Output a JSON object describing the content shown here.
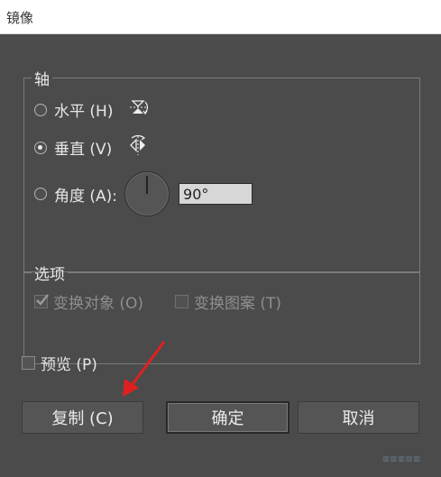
{
  "window": {
    "title": "镜像"
  },
  "axis": {
    "legend": "轴",
    "options": [
      {
        "label": "水平 (H)",
        "checked": false,
        "icon": "mirror-horizontal-icon"
      },
      {
        "label": "垂直 (V)",
        "checked": true,
        "icon": "mirror-vertical-icon"
      },
      {
        "label": "角度 (A):",
        "checked": false,
        "icon": "angle-dial-icon"
      }
    ],
    "angle_value": "90°"
  },
  "options": {
    "legend": "选项",
    "transform_objects": {
      "label": "变换对象 (O)",
      "checked": true,
      "disabled": true
    },
    "transform_patterns": {
      "label": "变换图案 (T)",
      "checked": false,
      "disabled": true
    }
  },
  "preview": {
    "label": "预览 (P)",
    "checked": false
  },
  "buttons": {
    "copy": "复制 (C)",
    "ok": "确定",
    "cancel": "取消"
  },
  "annotation": {
    "arrow_color": "#e02020"
  }
}
